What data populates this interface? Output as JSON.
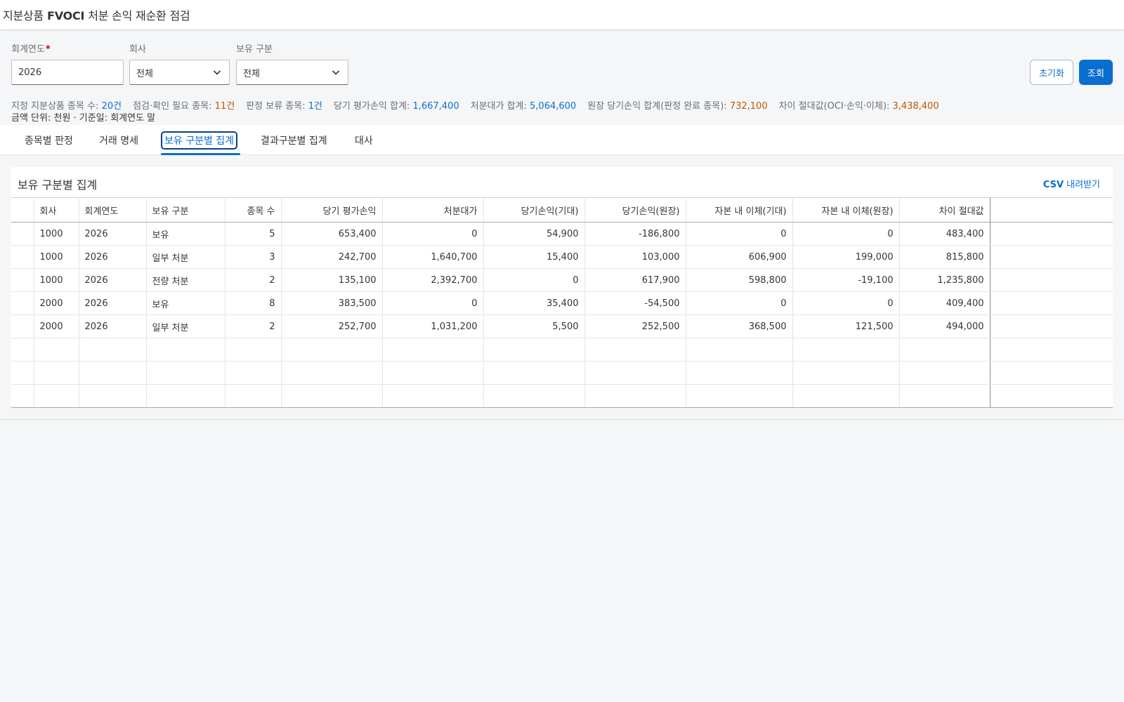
{
  "app": {
    "title_pre": "지분상품 ",
    "title_bold": "FVOCI",
    "title_post": " 처분 손익 재순환 점검"
  },
  "filters": {
    "fiscal_year_label": "회계연도",
    "fiscal_year_required": "*",
    "fiscal_year_value": "2026",
    "company_label": "회사",
    "company_value": "전체",
    "holding_label": "보유 구분",
    "holding_value": "전체",
    "reset_label": "초기화",
    "search_label": "조회"
  },
  "kpis": [
    {
      "label": "지정 지분상품 종목 수: ",
      "value": "20건",
      "tone": "blue"
    },
    {
      "label": "점검·확인 필요 종목: ",
      "value": "11건",
      "tone": "orange"
    },
    {
      "label": "판정 보류 종목: ",
      "value": "1건",
      "tone": "blue"
    },
    {
      "label": "당기 평가손익 합계: ",
      "value": "1,667,400",
      "tone": "blue"
    },
    {
      "label": "처분대가 합계: ",
      "value": "5,064,600",
      "tone": "blue"
    },
    {
      "label": "원장 당기손익 합계(판정 완료 종목): ",
      "value": "732,100",
      "tone": "orange"
    },
    {
      "label": "차이 절대값(OCI·손익·이체): ",
      "value": "3,438,400",
      "tone": "orange"
    }
  ],
  "units_note": "금액 단위: 천원 · 기준일: 회계연도 말",
  "tabs": [
    {
      "label": "종목별 판정",
      "active": false
    },
    {
      "label": "거래 명세",
      "active": false
    },
    {
      "label": "보유 구분별 집계",
      "active": true
    },
    {
      "label": "결과구분별 집계",
      "active": false
    },
    {
      "label": "대사",
      "active": false
    }
  ],
  "panel": {
    "title": "보유 구분별 집계",
    "csv_bold": "CSV",
    "csv_rest": " 내려받기"
  },
  "table": {
    "columns": [
      "",
      "회사",
      "회계연도",
      "보유 구분",
      "종목 수",
      "당기 평가손익",
      "처분대가",
      "당기손익(기대)",
      "당기손익(원장)",
      "자본 내 이체(기대)",
      "자본 내 이체(원장)",
      "차이 절대값"
    ],
    "rows": [
      [
        "",
        "1000",
        "2026",
        "보유",
        "5",
        "653,400",
        "0",
        "54,900",
        "-186,800",
        "0",
        "0",
        "483,400"
      ],
      [
        "",
        "1000",
        "2026",
        "일부 처분",
        "3",
        "242,700",
        "1,640,700",
        "15,400",
        "103,000",
        "606,900",
        "199,000",
        "815,800"
      ],
      [
        "",
        "1000",
        "2026",
        "전량 처분",
        "2",
        "135,100",
        "2,392,700",
        "0",
        "617,900",
        "598,800",
        "-19,100",
        "1,235,800"
      ],
      [
        "",
        "2000",
        "2026",
        "보유",
        "8",
        "383,500",
        "0",
        "35,400",
        "-54,500",
        "0",
        "0",
        "409,400"
      ],
      [
        "",
        "2000",
        "2026",
        "일부 처분",
        "2",
        "252,700",
        "1,031,200",
        "5,500",
        "252,500",
        "368,500",
        "121,500",
        "494,000"
      ]
    ],
    "empty_rows": 3
  }
}
